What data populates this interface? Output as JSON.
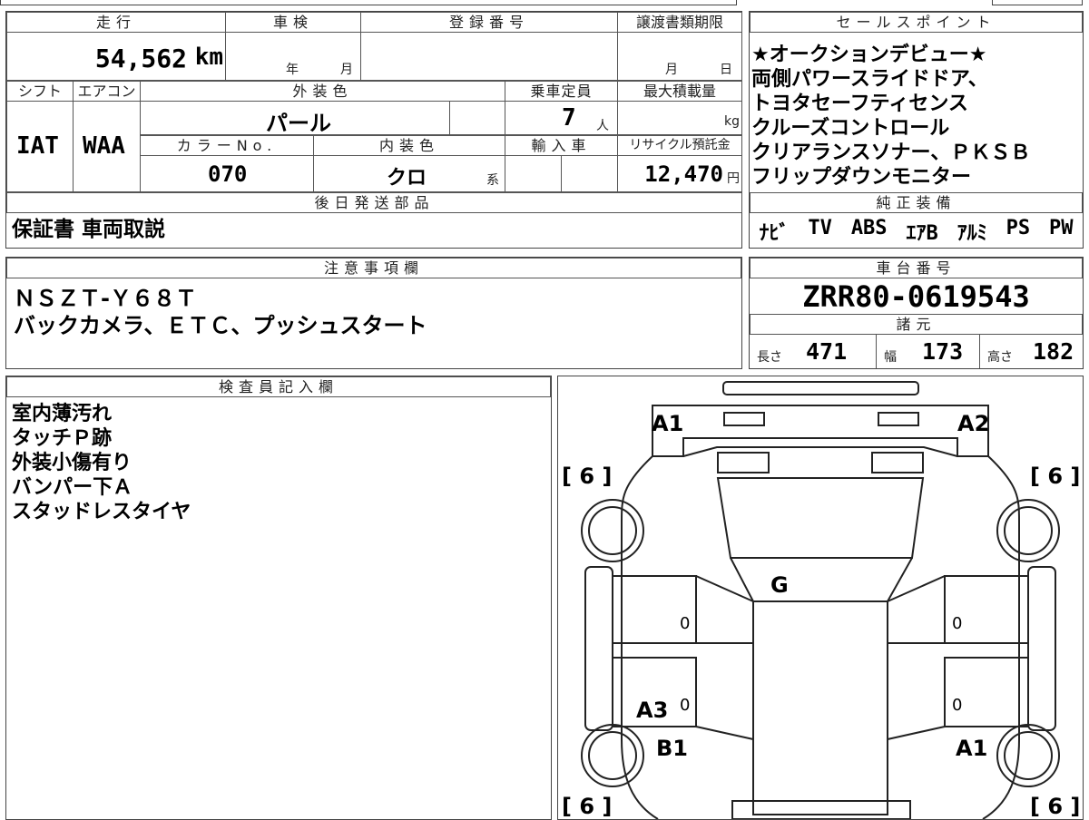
{
  "top_right_box": {
    "headers": {
      "mileage": "走行",
      "inspection": "車検",
      "registration": "登録番号",
      "transfer_deadline": "譲渡書類期限",
      "shift": "シフト",
      "aircon": "エアコン",
      "exterior_color": "外装色",
      "capacity": "乗車定員",
      "max_load": "最大積載量",
      "color_no": "カラーNo.",
      "interior_color": "内装色",
      "import": "輸入車",
      "recycle_fee": "リサイクル預託金",
      "later_parts": "後日発送部品"
    },
    "values": {
      "mileage": "54,562",
      "mileage_unit": "km",
      "inspection_year": "年",
      "inspection_month": "月",
      "transfer_month": "月",
      "transfer_day": "日",
      "shift": "IAT",
      "aircon": "WAA",
      "exterior_color": "パール",
      "capacity": "7",
      "capacity_unit": "人",
      "max_load_unit": "kg",
      "color_no": "070",
      "interior_color": "クロ",
      "interior_suffix": "系",
      "recycle_fee": "12,470",
      "recycle_unit": "円",
      "later_parts": "保証書 車両取説"
    }
  },
  "sales_points": {
    "header": "セールスポイント",
    "lines": [
      "★オークションデビュー★",
      "両側パワースライドドア、",
      "トヨタセーフティセンス",
      "クルーズコントロール",
      "クリアランスソナー、ＰＫＳＢ",
      "フリップダウンモニター"
    ]
  },
  "equipment": {
    "header": "純正装備",
    "items": [
      "ﾅﾋﾞ",
      "TV",
      "ABS",
      "ｴｱB",
      "ｱﾙﾐ",
      "PS",
      "PW"
    ]
  },
  "notes": {
    "header": "注意事項欄",
    "lines": [
      "ＮＳＺＴ-Ｙ６８Ｔ",
      "バックカメラ、ＥＴＣ、プッシュスタート"
    ]
  },
  "chassis": {
    "header": "車台番号",
    "number": "ZRR80-0619543",
    "spec_header": "諸元",
    "length_label": "長さ",
    "length": "471",
    "width_label": "幅",
    "width": "173",
    "height_label": "高さ",
    "height": "182"
  },
  "inspector": {
    "header": "検査員記入欄",
    "lines": [
      "室内薄汚れ",
      "タッチＰ跡",
      "外装小傷有り",
      "バンパー下Ａ",
      "スタッドレスタイヤ"
    ]
  },
  "diagram": {
    "labels": {
      "a1_front": "A1",
      "a2_front": "A2",
      "tire_fl": "[ 6 ]",
      "tire_fr": "[ 6 ]",
      "tire_rl": "[ 6 ]",
      "tire_rr": "[ 6 ]",
      "glass": "G",
      "door_l_front": "0",
      "door_r_front": "0",
      "door_l_rear": "0",
      "door_r_rear": "0",
      "a3": "A3",
      "b1": "B1",
      "a1_rear": "A1"
    }
  }
}
